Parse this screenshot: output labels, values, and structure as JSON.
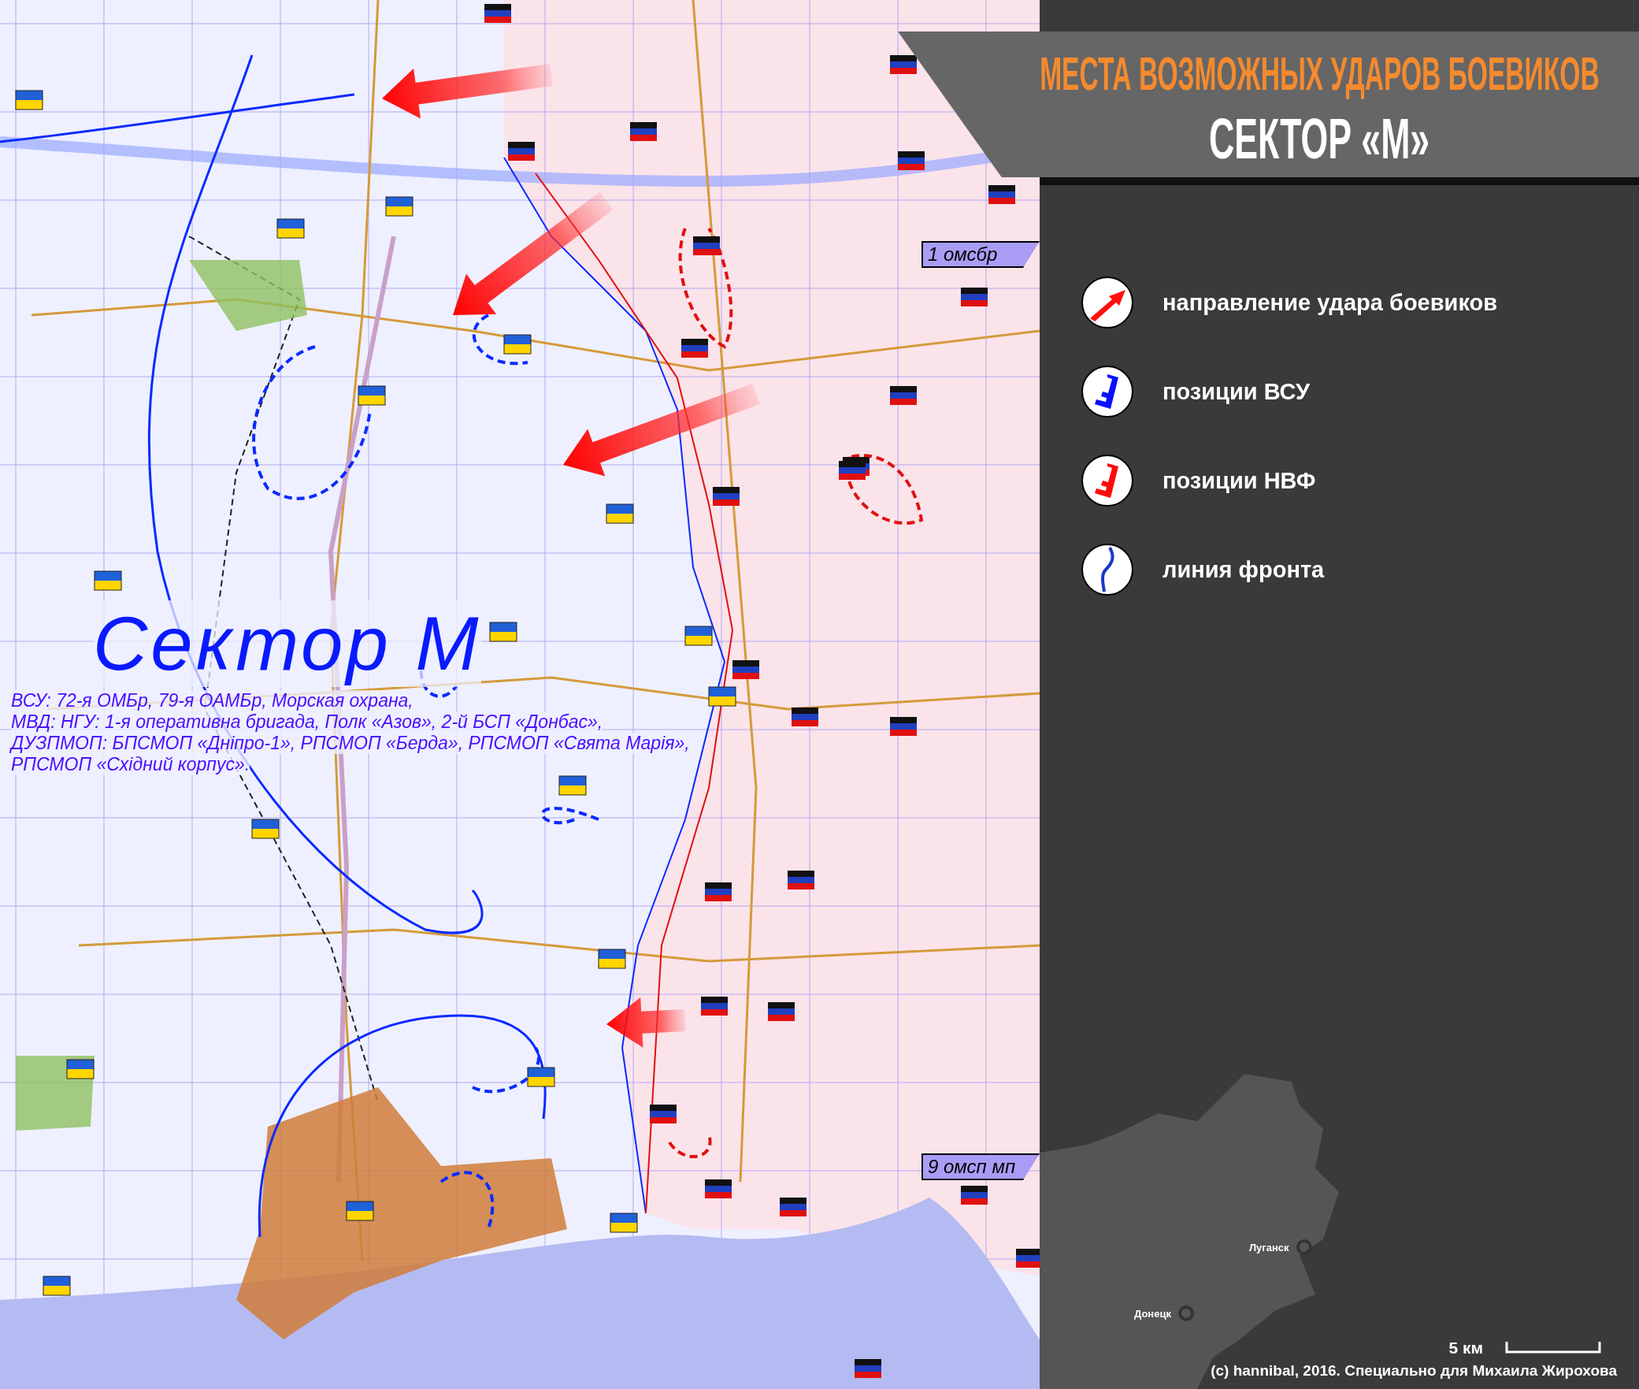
{
  "title": {
    "heading": "МЕСТА ВОЗМОЖНЫХ УДАРОВ БОЕВИКОВ",
    "subheading": "СЕКТОР «М»"
  },
  "map": {
    "sector_label": "Сектор М",
    "forces_note": [
      "ВСУ: 72-я ОМБр, 79-я ОАМБр, Морская охрана,",
      "МВД: НГУ: 1-я оперативна бригада, Полк «Азов», 2-й БСП «Донбас»,",
      "ДУЗПМОП: БПСМОП «Дніпро-1», РПСМОП «Берда», РПСМОП «Свята Марія»,",
      "РПСМОП «Східний корпус»."
    ],
    "unit_labels": [
      "1 омсбр",
      "9 омсп мп"
    ]
  },
  "legend": [
    {
      "kind": "attack",
      "label": "направление удара боевиков"
    },
    {
      "kind": "ua",
      "label": "позиции ВСУ"
    },
    {
      "kind": "sep",
      "label": "позиции НВФ"
    },
    {
      "kind": "front",
      "label": "линия фронта"
    }
  ],
  "inset_map": {
    "cities": [
      "Луганск",
      "Донецк"
    ]
  },
  "scale": {
    "label": "5 км"
  },
  "credit": "(c) hannibal, 2016. Специально для Михаила Жирохова"
}
